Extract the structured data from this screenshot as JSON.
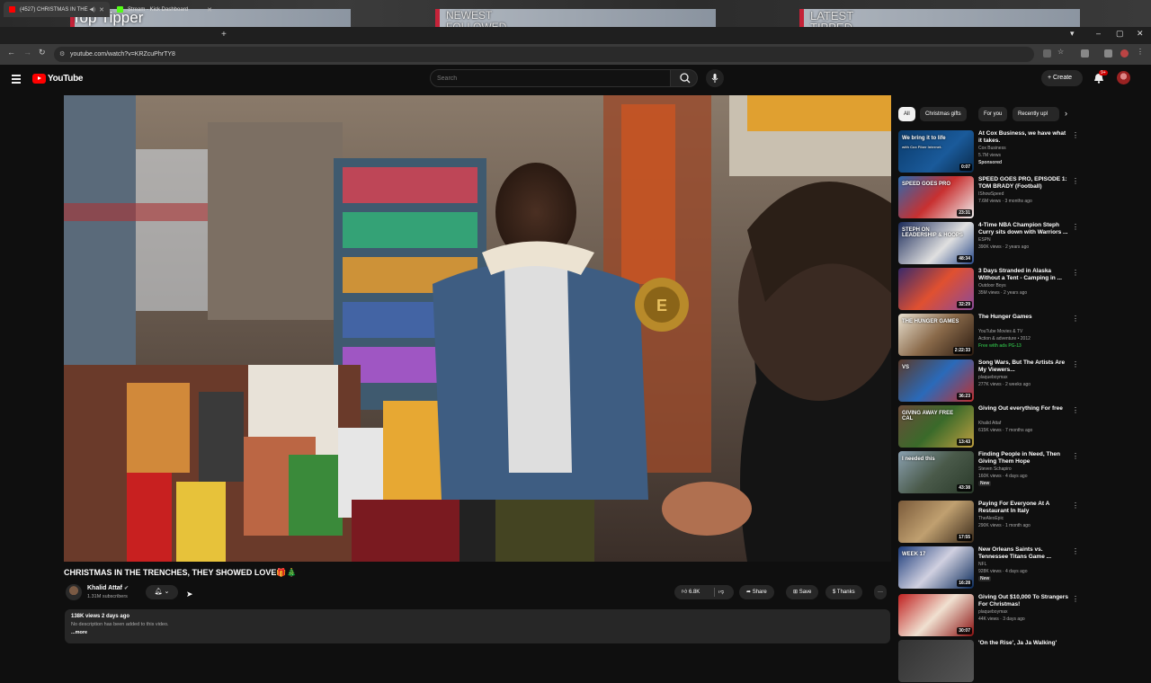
{
  "overlay": {
    "title": "Top Tipper",
    "panel1": "NEWEST FOLLOWED",
    "panel2": "LATEST TIPPED"
  },
  "browser": {
    "tabs": [
      {
        "label": "(4527) CHRISTMAS IN THE"
      },
      {
        "label": "Stream - Kick Dashboard"
      }
    ],
    "new_tab": "+",
    "url": "youtube.com/watch?v=KRZcuPhrTY8"
  },
  "header": {
    "logo": "YouTube",
    "search_placeholder": "Search",
    "create_label": "Create",
    "notif_count": "9+"
  },
  "video": {
    "title": "CHRISTMAS IN THE TRENCHES, THEY SHOWED LOVE🎁🎄",
    "channel": "Khalid Attaf",
    "subscribers": "1.31M subscribers",
    "likes": "6.8K",
    "share": "Share",
    "save": "Save",
    "thanks": "Thanks",
    "more": "···",
    "desc_meta": "138K views  2 days ago",
    "desc_body": "No description has been added to this video.",
    "desc_more": "...more"
  },
  "chips": [
    {
      "label": "All"
    },
    {
      "label": "Christmas gifts"
    },
    {
      "label": "For you"
    },
    {
      "label": "Recently upl"
    }
  ],
  "recommendations": [
    {
      "title": "At Cox Business, we have what it takes.",
      "channel": "Cox Business",
      "stats": "5.7M views",
      "tag": "Sponsored",
      "duration": "0:07",
      "thumb_text": "We bring it to life",
      "thumb_sub": "with Cox Fiber Internet."
    },
    {
      "title": "SPEED GOES PRO, EPISODE 1: TOM BRADY (Football)",
      "channel": "IShowSpeed",
      "stats": "7.6M views · 3 months ago",
      "tag": "",
      "duration": "23:31",
      "thumb_text": "SPEED GOES PRO",
      "thumb_sub": ""
    },
    {
      "title": "4-Time NBA Champion Steph Curry sits down with Warriors ...",
      "channel": "ESPN",
      "stats": "390K views · 2 years ago",
      "tag": "",
      "duration": "48:34",
      "thumb_text": "STEPH ON LEADERSHIP & HOOPS",
      "thumb_sub": ""
    },
    {
      "title": "3 Days Stranded in Alaska Without a Tent - Camping in ...",
      "channel": "Outdoor Boys",
      "stats": "35M views · 2 years ago",
      "tag": "",
      "duration": "32:29",
      "thumb_text": "",
      "thumb_sub": ""
    },
    {
      "title": "The Hunger Games",
      "channel": "YouTube Movies & TV",
      "stats": "Action & adventure • 2012",
      "tag": "Free with ads  PG-13",
      "duration": "2:22:33",
      "thumb_text": "THE HUNGER GAMES",
      "thumb_sub": ""
    },
    {
      "title": "Song Wars, But The Artists Are My Viewers...",
      "channel": "plaqueboymax",
      "stats": "277K views · 2 weeks ago",
      "tag": "",
      "duration": "36:23",
      "thumb_text": "VS",
      "thumb_sub": ""
    },
    {
      "title": "Giving Out everything For free",
      "channel": "Khalid Attaf",
      "stats": "615K views · 7 months ago",
      "tag": "",
      "duration": "13:43",
      "thumb_text": "GIVING AWAY FREE CAL",
      "thumb_sub": ""
    },
    {
      "title": "Finding People in Need, Then Giving Them Hope",
      "channel": "Steven Schapiro",
      "stats": "160K views · 4 days ago",
      "tag": "New",
      "duration": "43:38",
      "thumb_text": "I needed this",
      "thumb_sub": ""
    },
    {
      "title": "Paying For Everyone At A Restaurant In Italy",
      "channel": "TheAlexEpic",
      "stats": "290K views · 1 month ago",
      "tag": "",
      "duration": "17:55",
      "thumb_text": "",
      "thumb_sub": ""
    },
    {
      "title": "New Orleans Saints vs. Tennessee Titans Game ...",
      "channel": "NFL",
      "stats": "928K views · 4 days ago",
      "tag": "New",
      "duration": "16:28",
      "thumb_text": "WEEK 17",
      "thumb_sub": ""
    },
    {
      "title": "Giving Out $10,000 To Strangers For Christmas!",
      "channel": "plaqueboymax",
      "stats": "44K views · 3 days ago",
      "tag": "",
      "duration": "30:07",
      "thumb_text": "",
      "thumb_sub": ""
    },
    {
      "title": "'On the Rise', Ja Ja Walking'",
      "channel": "",
      "stats": "",
      "tag": "",
      "duration": "",
      "thumb_text": "",
      "thumb_sub": ""
    }
  ],
  "colors": {
    "background": "#0f0f0f",
    "accent_red": "#ff0000",
    "chip_bg": "#272727"
  }
}
